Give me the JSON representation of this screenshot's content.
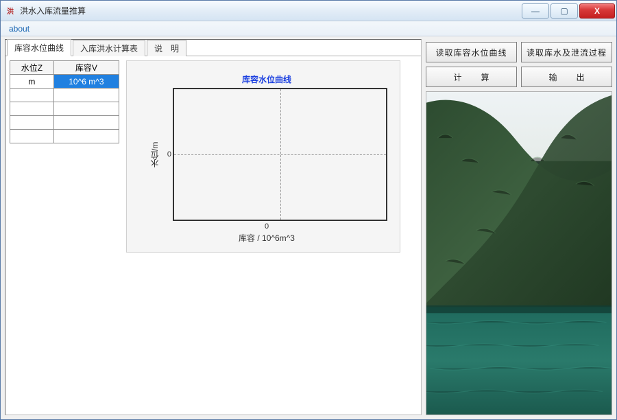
{
  "window": {
    "title": "洪水入库流量推算",
    "icon_text": "洪"
  },
  "menu": {
    "about": "about"
  },
  "tabs": [
    {
      "label": "库容水位曲线",
      "active": true
    },
    {
      "label": "入库洪水计算表",
      "active": false
    },
    {
      "label": "说　明",
      "active": false
    }
  ],
  "grid": {
    "headers": {
      "col1": "水位Z",
      "col2": "库容V"
    },
    "units": {
      "col1": "m",
      "col2": "10^6 m^3"
    },
    "rows": [
      {
        "z": "",
        "v": ""
      },
      {
        "z": "",
        "v": ""
      },
      {
        "z": "",
        "v": ""
      },
      {
        "z": "",
        "v": ""
      }
    ]
  },
  "chart_data": {
    "type": "line",
    "title": "库容水位曲线",
    "xlabel": "库容 / 10^6m^3",
    "ylabel": "水位/m",
    "xlim": [
      0,
      0
    ],
    "ylim": [
      0,
      0
    ],
    "x_ticks": [
      "0"
    ],
    "y_ticks": [
      "0"
    ],
    "series": [
      {
        "name": "库容水位曲线",
        "values": []
      }
    ]
  },
  "buttons": {
    "read_curve": "读取库容水位曲线",
    "read_flow": "读取库水及泄流过程",
    "compute": "计　算",
    "output": "输　出"
  },
  "side_image": {
    "alt": "reservoir-mountain-photo"
  },
  "win_controls": {
    "minimize": "—",
    "maximize": "▢",
    "close": "X"
  }
}
